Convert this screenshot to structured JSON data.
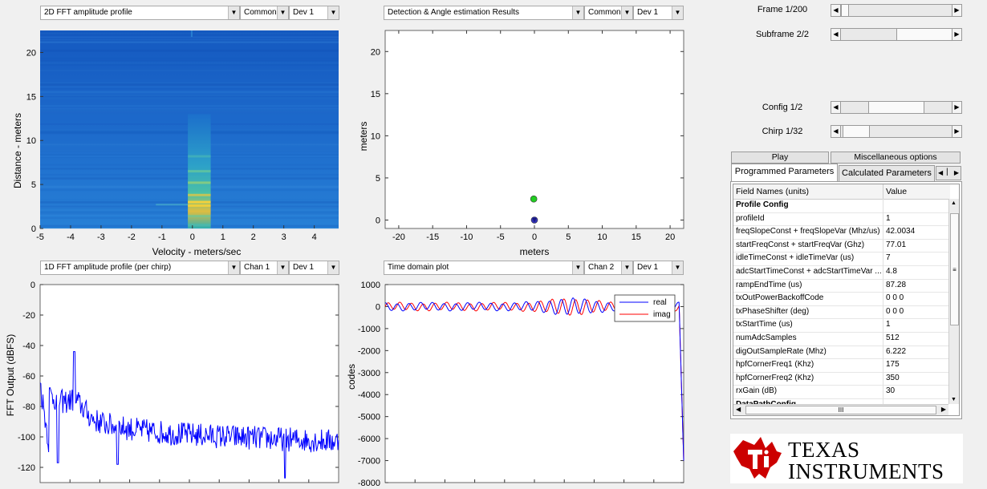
{
  "colors": {
    "series_blue": "#0000ff",
    "series_red": "#ff0000",
    "ti_red": "#cc0000",
    "heatmap_bg": "#1c68c8"
  },
  "panels": {
    "top_left": {
      "selector": "2D FFT amplitude profile",
      "opt1": "Common",
      "opt2": "Dev 1"
    },
    "top_right": {
      "selector": "Detection & Angle estimation Results",
      "opt1": "Common",
      "opt2": "Dev 1"
    },
    "bottom_left": {
      "selector": "1D FFT amplitude profile (per chirp)",
      "opt1": "Chan 1",
      "opt2": "Dev 1"
    },
    "bottom_right": {
      "selector": "Time domain plot",
      "opt1": "Chan 2",
      "opt2": "Dev 1"
    }
  },
  "sliders": {
    "frame": {
      "label": "Frame 1/200",
      "level": 0.005
    },
    "subframe": {
      "label": "Subframe 2/2",
      "level": 1.0
    },
    "config": {
      "label": "Config 1/2",
      "level": 0.5
    },
    "chirp": {
      "label": "Chirp 1/32",
      "level": 0.03
    }
  },
  "buttons": {
    "play": "Play",
    "misc": "Miscellaneous options"
  },
  "tabs": {
    "programmed": "Programmed Parameters",
    "calculated": "Calculated Parameters"
  },
  "table": {
    "headers": [
      "Field Names    (units)",
      "Value"
    ],
    "rows": [
      [
        "Profile Config",
        ""
      ],
      [
        "profileId",
        "1"
      ],
      [
        "freqSlopeConst + freqSlopeVar (Mhz/us)",
        "42.0034"
      ],
      [
        "startFreqConst + startFreqVar (Ghz)",
        "77.01"
      ],
      [
        "idleTimeConst + idleTimeVar (us)",
        "7"
      ],
      [
        "adcStartTimeConst + adcStartTimeVar ...",
        "4.8"
      ],
      [
        "rampEndTime (us)",
        "87.28"
      ],
      [
        "txOutPowerBackoffCode",
        "0 0 0"
      ],
      [
        "txPhaseShifter (deg)",
        "0 0 0"
      ],
      [
        "txStartTime (us)",
        "1"
      ],
      [
        "numAdcSamples",
        "512"
      ],
      [
        "digOutSampleRate (Mhz)",
        "6.222"
      ],
      [
        "hpfCornerFreq1 (Khz)",
        "175"
      ],
      [
        "hpfCornerFreq2 (Khz)",
        "350"
      ],
      [
        "rxGain (dB)",
        "30"
      ],
      [
        "DataPathConfig",
        ""
      ]
    ],
    "hscroll_grip": "III"
  },
  "logo": {
    "line1": "TEXAS",
    "line2": "INSTRUMENTS"
  },
  "chart_data": [
    {
      "type": "heatmap",
      "xlabel": "Velocity - meters/sec",
      "ylabel": "Distance - meters",
      "xlim": [
        -5,
        4.8
      ],
      "ylim": [
        0,
        22.5
      ],
      "xticks": [
        "-5",
        "-4",
        "-3",
        "-2",
        "-1",
        "0",
        "1",
        "2",
        "3",
        "4"
      ],
      "yticks": [
        "0",
        "5",
        "10",
        "15",
        "20"
      ]
    },
    {
      "type": "scatter",
      "xlabel": "meters",
      "ylabel": "meters",
      "xlim": [
        -22,
        22
      ],
      "ylim": [
        -1,
        22.5
      ],
      "xticks": [
        "-20",
        "-15",
        "-10",
        "-5",
        "0",
        "5",
        "10",
        "15",
        "20"
      ],
      "yticks": [
        "0",
        "5",
        "10",
        "15",
        "20"
      ],
      "points": [
        {
          "x": -0.1,
          "y": 2.5,
          "color": "#22cc22"
        },
        {
          "x": 0,
          "y": 0,
          "color": "#3333bb"
        }
      ]
    },
    {
      "type": "line",
      "xlabel": "",
      "ylabel": "FFT Output (dBFS)",
      "ylim": [
        -130,
        0
      ],
      "yticks": [
        "0",
        "-20",
        "-40",
        "-60",
        "-80",
        "-100",
        "-120"
      ],
      "series": [
        {
          "name": "",
          "color": "#0000ff"
        }
      ]
    },
    {
      "type": "line",
      "xlabel": "",
      "ylabel": "codes",
      "ylim": [
        -8000,
        1000
      ],
      "yticks": [
        "1000",
        "0",
        "-1000",
        "-2000",
        "-3000",
        "-4000",
        "-5000",
        "-6000",
        "-7000",
        "-8000"
      ],
      "series": [
        {
          "name": "real",
          "color": "#0000ff"
        },
        {
          "name": "imag",
          "color": "#ff0000"
        }
      ]
    }
  ]
}
